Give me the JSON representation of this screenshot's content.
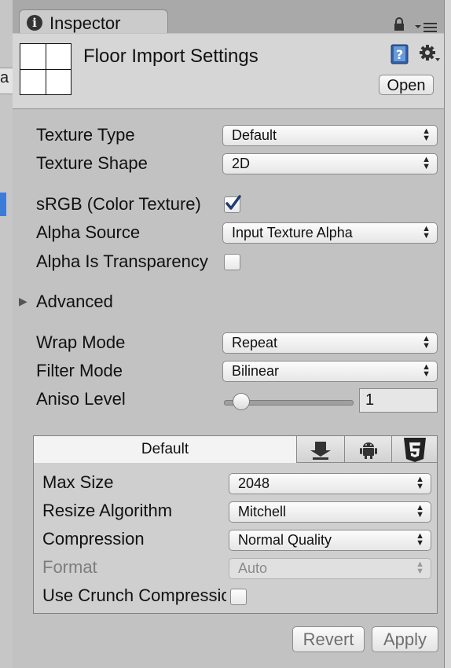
{
  "window": {
    "tab_title": "Inspector"
  },
  "header": {
    "title": "Floor Import Settings",
    "open_label": "Open"
  },
  "left_fragment": "a",
  "settings": {
    "texture_type": {
      "label": "Texture Type",
      "value": "Default"
    },
    "texture_shape": {
      "label": "Texture Shape",
      "value": "2D"
    },
    "srgb": {
      "label": "sRGB (Color Texture)",
      "checked": true
    },
    "alpha_source": {
      "label": "Alpha Source",
      "value": "Input Texture Alpha"
    },
    "alpha_transparency": {
      "label": "Alpha Is Transparency",
      "checked": false
    },
    "advanced": {
      "label": "Advanced",
      "expanded": false
    },
    "wrap_mode": {
      "label": "Wrap Mode",
      "value": "Repeat"
    },
    "filter_mode": {
      "label": "Filter Mode",
      "value": "Bilinear"
    },
    "aniso_level": {
      "label": "Aniso Level",
      "value": "1",
      "slider_fraction": 0.08
    }
  },
  "platform": {
    "tabs": [
      {
        "label": "Default",
        "icon": "default",
        "selected": true
      },
      {
        "label": "",
        "icon": "download-icon"
      },
      {
        "label": "",
        "icon": "android-icon"
      },
      {
        "label": "",
        "icon": "html5-icon"
      }
    ],
    "max_size": {
      "label": "Max Size",
      "value": "2048"
    },
    "resize_algorithm": {
      "label": "Resize Algorithm",
      "value": "Mitchell"
    },
    "compression": {
      "label": "Compression",
      "value": "Normal Quality"
    },
    "format": {
      "label": "Format",
      "value": "Auto",
      "disabled": true
    },
    "crunch": {
      "label": "Use Crunch Compression",
      "checked": false
    }
  },
  "footer": {
    "revert_label": "Revert",
    "apply_label": "Apply"
  },
  "colors": {
    "selection": "#3d7bd9",
    "panel": "#c2c2c2",
    "header": "#d6d6d6"
  }
}
